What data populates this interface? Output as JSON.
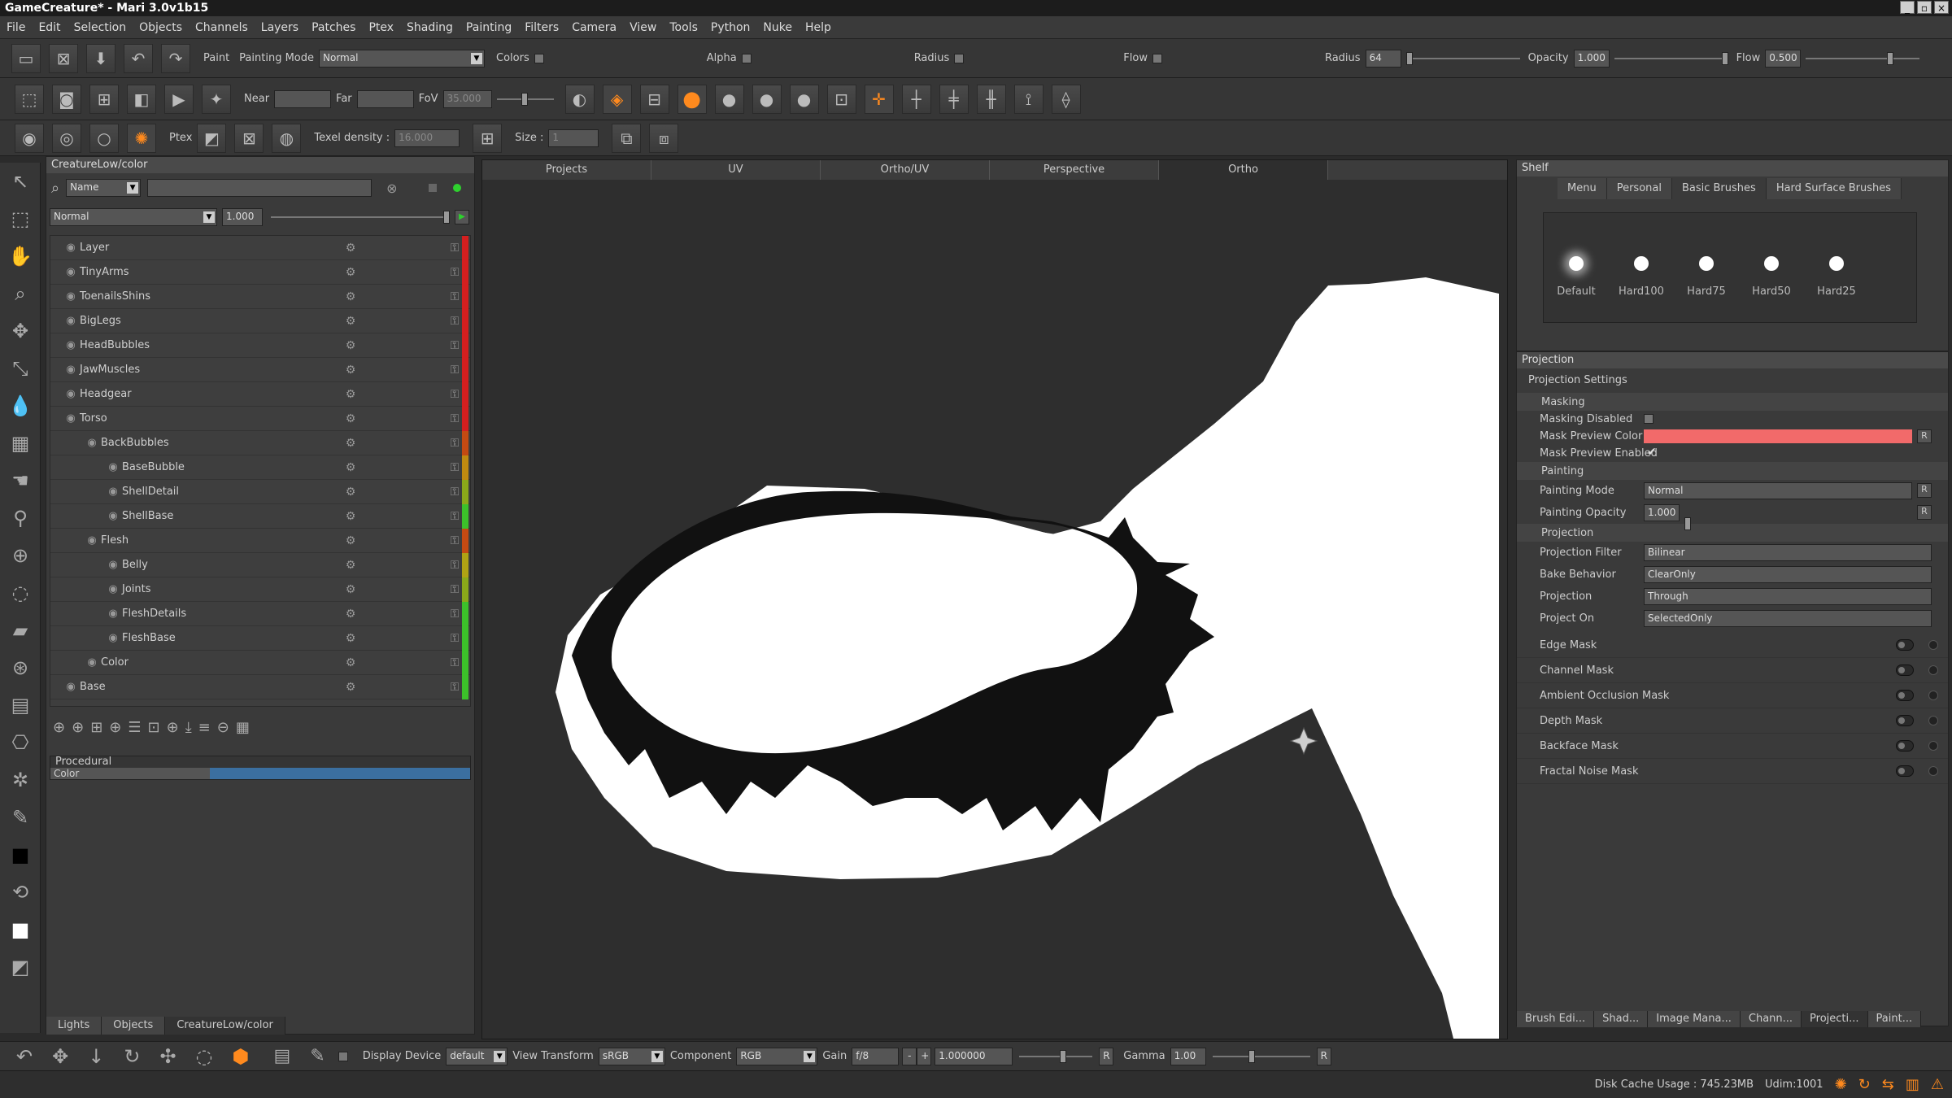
{
  "window": {
    "title": "GameCreature* - Mari 3.0v1b15",
    "controls": [
      "_",
      "▫",
      "×"
    ]
  },
  "menu": [
    "File",
    "Edit",
    "Selection",
    "Objects",
    "Channels",
    "Layers",
    "Patches",
    "Ptex",
    "Shading",
    "Painting",
    "Filters",
    "Camera",
    "View",
    "Tools",
    "Python",
    "Nuke",
    "Help"
  ],
  "toolbar1": {
    "paint_label": "Paint",
    "painting_mode_label": "Painting Mode",
    "painting_mode_value": "Normal",
    "colors_label": "Colors",
    "alpha_label": "Alpha",
    "radius_label": "Radius",
    "flow_label": "Flow",
    "radius2_label": "Radius",
    "radius2_value": "64",
    "opacity_label": "Opacity",
    "opacity_value": "1.000",
    "flow2_label": "Flow",
    "flow2_value": "0.500"
  },
  "toolbar2": {
    "near_label": "Near",
    "far_label": "Far",
    "fov_label": "FoV",
    "fov_value": "35.000"
  },
  "toolbar3": {
    "ptex_label": "Ptex",
    "texel_label": "Texel density :",
    "texel_value": "16.000",
    "size_label": "Size :",
    "size_value": "1"
  },
  "layers": {
    "title": "CreatureLow/color",
    "filter_combo": "Name",
    "blend_mode": "Normal",
    "opacity": "1.000",
    "items": [
      {
        "name": "Layer",
        "indent": 0,
        "bar": "#d41f1f"
      },
      {
        "name": "TinyArms",
        "indent": 0,
        "bar": "#d41f1f"
      },
      {
        "name": "ToenailsShins",
        "indent": 0,
        "bar": "#d41f1f"
      },
      {
        "name": "BigLegs",
        "indent": 0,
        "bar": "#d41f1f"
      },
      {
        "name": "HeadBubbles",
        "indent": 0,
        "bar": "#d41f1f"
      },
      {
        "name": "JawMuscles",
        "indent": 0,
        "bar": "#d41f1f"
      },
      {
        "name": "Headgear",
        "indent": 0,
        "bar": "#d41f1f"
      },
      {
        "name": "Torso",
        "indent": 0,
        "bar": "#d41f1f"
      },
      {
        "name": "BackBubbles",
        "indent": 1,
        "bar": "#c44a12"
      },
      {
        "name": "BaseBubble",
        "indent": 2,
        "bar": "#c08a10"
      },
      {
        "name": "ShellDetail",
        "indent": 2,
        "bar": "#8aa81a"
      },
      {
        "name": "ShellBase",
        "indent": 2,
        "bar": "#3cc12a"
      },
      {
        "name": "Flesh",
        "indent": 1,
        "bar": "#c44a12"
      },
      {
        "name": "Belly",
        "indent": 2,
        "bar": "#b0a214"
      },
      {
        "name": "Joints",
        "indent": 2,
        "bar": "#8aa81a"
      },
      {
        "name": "FleshDetails",
        "indent": 2,
        "bar": "#3cc12a"
      },
      {
        "name": "FleshBase",
        "indent": 2,
        "bar": "#3cc12a"
      },
      {
        "name": "Color",
        "indent": 1,
        "bar": "#3cc12a"
      },
      {
        "name": "Base",
        "indent": 0,
        "bar": "#3cc12a"
      }
    ],
    "procedural_label": "Procedural",
    "procedural_row": "Color",
    "bottom_tabs": [
      "Lights",
      "Objects",
      "CreatureLow/color"
    ]
  },
  "viewport": {
    "tabs": [
      "Projects",
      "UV",
      "Ortho/UV",
      "Perspective",
      "Ortho"
    ],
    "active_tab": "Ortho"
  },
  "shelf": {
    "title": "Shelf",
    "tabs": [
      "Menu",
      "Personal",
      "Basic Brushes",
      "Hard Surface Brushes"
    ],
    "active_tab": "Basic Brushes",
    "brushes": [
      "Default",
      "Hard100",
      "Hard75",
      "Hard50",
      "Hard25"
    ]
  },
  "projection": {
    "title": "Projection",
    "settings_label": "Projection Settings",
    "masking_label": "Masking",
    "masking_disabled_label": "Masking Disabled",
    "mask_preview_color_label": "Mask Preview Color",
    "mask_preview_color": "#f26a6a",
    "mask_preview_enabled_label": "Mask Preview Enabled",
    "painting_label": "Painting",
    "painting_mode_label": "Painting Mode",
    "painting_mode_value": "Normal",
    "painting_opacity_label": "Painting Opacity",
    "painting_opacity_value": "1.000",
    "projection_label": "Projection",
    "filter_label": "Projection Filter",
    "filter_value": "Bilinear",
    "bake_label": "Bake Behavior",
    "bake_value": "ClearOnly",
    "proj_label": "Projection",
    "proj_value": "Through",
    "project_on_label": "Project On",
    "project_on_value": "SelectedOnly",
    "masks": [
      "Edge Mask",
      "Channel Mask",
      "Ambient Occlusion Mask",
      "Depth Mask",
      "Backface Mask",
      "Fractal Noise Mask"
    ],
    "reset_label": "R",
    "bottom_tabs": [
      "Brush Edi...",
      "Shad...",
      "Image Mana...",
      "Chann...",
      "Projecti...",
      "Paint..."
    ]
  },
  "bottombar": {
    "display_device_label": "Display Device",
    "display_device_value": "default",
    "view_transform_label": "View Transform",
    "view_transform_value": "sRGB",
    "component_label": "Component",
    "component_value": "RGB",
    "gain_label": "Gain",
    "gain_value": "f/8",
    "gain_minus": "-",
    "gain_plus": "+",
    "gain_number": "1.000000",
    "gamma_label": "Gamma",
    "gamma_value": "1.00",
    "r_label": "R"
  },
  "status": {
    "disk_cache": "Disk Cache Usage : 745.23MB",
    "udim": "Udim:1001"
  }
}
